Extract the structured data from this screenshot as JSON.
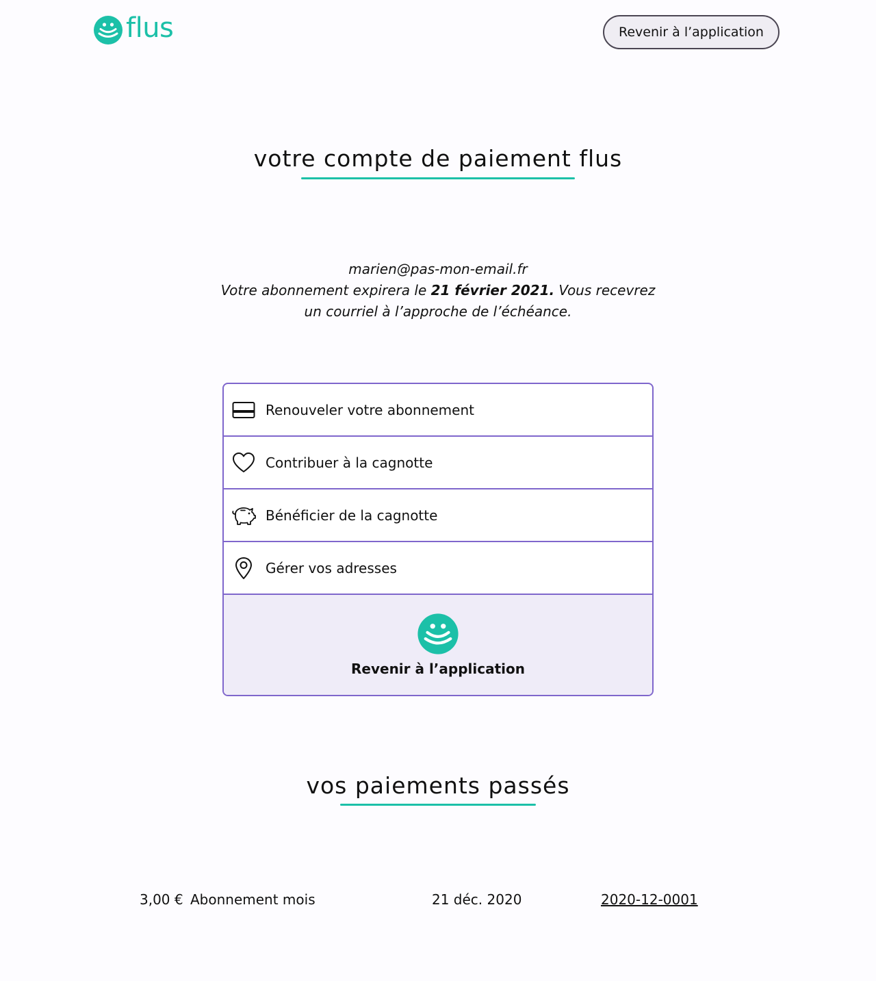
{
  "header": {
    "logo_text": "flus",
    "back_button_label": "Revenir à l’application"
  },
  "account": {
    "title": "votre compte de paiement flus",
    "email": "marien@pas-mon-email.fr",
    "expiry_prefix": "Votre abonnement expirera le ",
    "expiry_date": "21 février 2021.",
    "expiry_suffix": " Vous recevrez",
    "expiry_line2": "un courriel à l’approche de l’échéance."
  },
  "menu": {
    "items": [
      {
        "label": "Renouveler votre abonnement",
        "icon": "credit-card-icon"
      },
      {
        "label": "Contribuer à la cagnotte",
        "icon": "heart-icon"
      },
      {
        "label": "Bénéficier de la cagnotte",
        "icon": "piggy-bank-icon"
      },
      {
        "label": "Gérer vos adresses",
        "icon": "map-pin-icon"
      }
    ],
    "footer_label": "Revenir à l’application"
  },
  "payments": {
    "title": "vos paiements passés",
    "rows": [
      {
        "amount": "3,00 €",
        "label": "Abonnement mois",
        "date": "21 déc. 2020",
        "invoice": "2020-12-0001"
      }
    ]
  },
  "colors": {
    "brand": "#1cc0a8",
    "accent": "#7f66cc",
    "footer_bg": "#efecf8",
    "page_bg": "#fdfcff"
  }
}
